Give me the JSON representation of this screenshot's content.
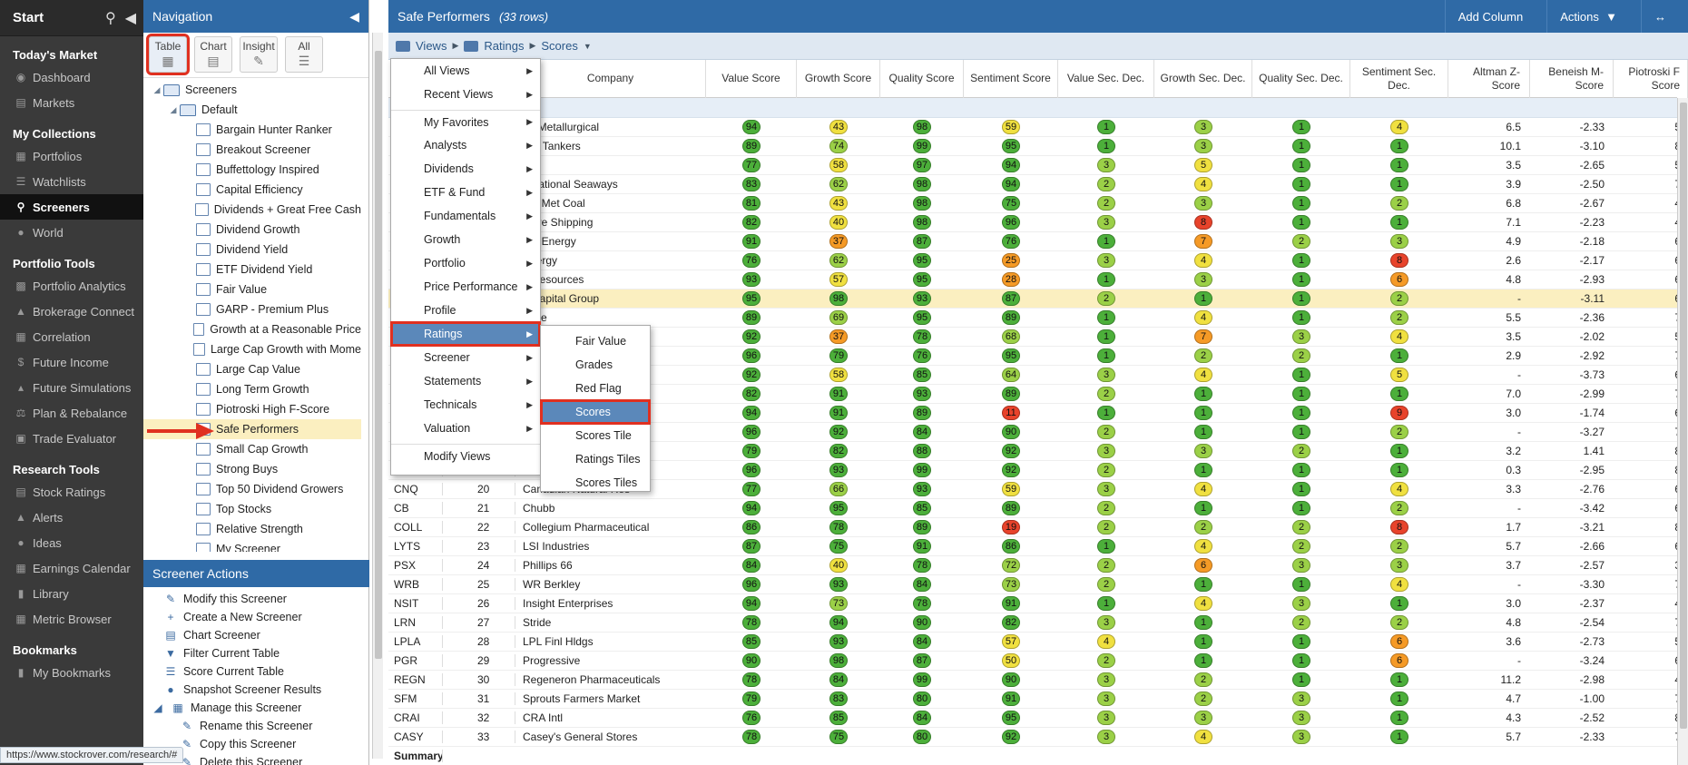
{
  "sidebar": {
    "start": "Start",
    "sections": [
      {
        "title": "Today's Market",
        "items": [
          {
            "label": "Dashboard",
            "icon": "gauge-icon"
          },
          {
            "label": "Markets",
            "icon": "chart-icon"
          }
        ]
      },
      {
        "title": "My Collections",
        "items": [
          {
            "label": "Portfolios",
            "icon": "building-icon"
          },
          {
            "label": "Watchlists",
            "icon": "list-icon"
          },
          {
            "label": "Screeners",
            "icon": "search-icon",
            "active": true
          },
          {
            "label": "World",
            "icon": "globe-icon"
          }
        ]
      },
      {
        "title": "Portfolio Tools",
        "items": [
          {
            "label": "Portfolio Analytics",
            "icon": "bars-icon"
          },
          {
            "label": "Brokerage Connect",
            "icon": "bank-icon"
          },
          {
            "label": "Correlation",
            "icon": "grid-icon"
          },
          {
            "label": "Future Income",
            "icon": "dollar-icon"
          },
          {
            "label": "Future Simulations",
            "icon": "flask-icon"
          },
          {
            "label": "Plan & Rebalance",
            "icon": "scale-icon"
          },
          {
            "label": "Trade Evaluator",
            "icon": "calculator-icon"
          }
        ]
      },
      {
        "title": "Research Tools",
        "items": [
          {
            "label": "Stock Ratings",
            "icon": "chart-icon"
          },
          {
            "label": "Alerts",
            "icon": "bell-icon"
          },
          {
            "label": "Ideas",
            "icon": "bulb-icon"
          },
          {
            "label": "Earnings Calendar",
            "icon": "calendar-icon"
          },
          {
            "label": "Library",
            "icon": "book-icon"
          },
          {
            "label": "Metric Browser",
            "icon": "table-icon"
          }
        ]
      },
      {
        "title": "Bookmarks",
        "items": [
          {
            "label": "My Bookmarks",
            "icon": "bookmark-icon"
          }
        ]
      }
    ]
  },
  "nav": {
    "title": "Navigation",
    "view_buttons": [
      {
        "label": "Table",
        "selected": true
      },
      {
        "label": "Chart"
      },
      {
        "label": "Insight"
      },
      {
        "label": "All"
      }
    ],
    "tree_root": "Screeners",
    "tree_folder": "Default",
    "screeners": [
      "Bargain Hunter Ranker",
      "Breakout Screener",
      "Buffettology Inspired",
      "Capital Efficiency",
      "Dividends + Great Free Cash",
      "Dividend Growth",
      "Dividend Yield",
      "ETF Dividend Yield",
      "Fair Value",
      "GARP - Premium Plus",
      "Growth at a Reasonable Price",
      "Large Cap Growth with Mome",
      "Large Cap Value",
      "Long Term Growth",
      "Piotroski High F-Score",
      "Safe Performers",
      "Small Cap Growth",
      "Strong Buys",
      "Top 50 Dividend Growers",
      "Top Stocks",
      "Relative Strength",
      "My Screener"
    ],
    "highlighted": "Safe Performers",
    "actions_title": "Screener Actions",
    "actions": [
      "Modify this Screener",
      "Create a New Screener",
      "Chart Screener",
      "Filter Current Table",
      "Score Current Table",
      "Snapshot Screener Results"
    ],
    "manage_group": "Manage this Screener",
    "manage_items": [
      "Rename this Screener",
      "Copy this Screener",
      "Delete this Screener"
    ],
    "status_url": "https://www.stockrover.com/research/#"
  },
  "main": {
    "title": "Safe Performers",
    "row_count": "(33 rows)",
    "add_column": "Add Column",
    "actions": "Actions",
    "crumbs": [
      "Views",
      "Ratings",
      "Scores"
    ]
  },
  "table": {
    "headers": [
      "Company",
      "Value Score",
      "Growth Score",
      "Quality Score",
      "Sentiment Score",
      "Value Sec. Dec.",
      "Growth Sec. Dec.",
      "Quality Sec. Dec.",
      "Sentiment Sec. Dec.",
      "Altman Z-Score",
      "Beneish M-Score",
      "Piotroski F Score"
    ],
    "colors": {
      "green": "#4caf3a",
      "lightgreen": "#9bd047",
      "yellow": "#f0e040",
      "orange": "#f59a26",
      "red": "#e8432b"
    },
    "rows": [
      {
        "ticker": "",
        "rank": "",
        "company": "na Metallurgical",
        "v": [
          94,
          43,
          98,
          59
        ],
        "d": [
          1,
          3,
          1,
          4
        ],
        "alt": "6.5",
        "ben": "-2.33",
        "pio": "5"
      },
      {
        "ticker": "",
        "rank": "",
        "company": "kay Tankers",
        "v": [
          89,
          74,
          99,
          95
        ],
        "d": [
          1,
          3,
          1,
          1
        ],
        "alt": "10.1",
        "ben": "-3.10",
        "pio": "8"
      },
      {
        "ticker": "",
        "rank": "",
        "company": "RM",
        "v": [
          77,
          58,
          97,
          94
        ],
        "d": [
          3,
          5,
          1,
          1
        ],
        "alt": "3.5",
        "ben": "-2.65",
        "pio": "5"
      },
      {
        "ticker": "",
        "rank": "",
        "company": "ernational Seaways",
        "v": [
          83,
          62,
          98,
          94
        ],
        "d": [
          2,
          4,
          1,
          1
        ],
        "alt": "3.9",
        "ben": "-2.50",
        "pio": "7"
      },
      {
        "ticker": "",
        "rank": "",
        "company": "rior Met Coal",
        "v": [
          81,
          43,
          98,
          75
        ],
        "d": [
          2,
          3,
          1,
          2
        ],
        "alt": "6.8",
        "ben": "-2.67",
        "pio": "4"
      },
      {
        "ticker": "",
        "rank": "",
        "company": "more Shipping",
        "v": [
          82,
          40,
          98,
          96
        ],
        "d": [
          3,
          8,
          1,
          1
        ],
        "alt": "7.1",
        "ben": "-2.23",
        "pio": "4"
      },
      {
        "ticker": "",
        "rank": "",
        "company": "ero Energy",
        "v": [
          91,
          37,
          87,
          76
        ],
        "d": [
          1,
          7,
          2,
          3
        ],
        "alt": "4.9",
        "ben": "-2.18",
        "pio": "6"
      },
      {
        "ticker": "",
        "rank": "",
        "company": "Energy",
        "v": [
          76,
          62,
          95,
          25
        ],
        "d": [
          3,
          4,
          1,
          8
        ],
        "alt": "2.6",
        "ben": "-2.17",
        "pio": "6"
      },
      {
        "ticker": "",
        "rank": "",
        "company": "n Resources",
        "v": [
          93,
          57,
          95,
          28
        ],
        "d": [
          1,
          3,
          1,
          6
        ],
        "alt": "4.8",
        "ben": "-2.93",
        "pio": "6"
      },
      {
        "ticker": "",
        "rank": "",
        "company": "n Capital Group",
        "v": [
          95,
          98,
          93,
          87
        ],
        "d": [
          2,
          1,
          1,
          2
        ],
        "alt": "-",
        "ben": "-3.11",
        "pio": "6",
        "hl": true
      },
      {
        "ticker": "",
        "rank": "",
        "company": "Fuse",
        "v": [
          89,
          69,
          95,
          89
        ],
        "d": [
          1,
          4,
          1,
          2
        ],
        "alt": "5.5",
        "ben": "-2.36",
        "pio": "7"
      },
      {
        "ticker": "",
        "rank": "",
        "company": "",
        "v": [
          92,
          37,
          78,
          68
        ],
        "d": [
          1,
          7,
          3,
          4
        ],
        "alt": "3.5",
        "ben": "-2.02",
        "pio": "5"
      },
      {
        "ticker": "",
        "rank": "",
        "company": "",
        "v": [
          96,
          79,
          76,
          95
        ],
        "d": [
          1,
          2,
          2,
          1
        ],
        "alt": "2.9",
        "ben": "-2.92",
        "pio": "7"
      },
      {
        "ticker": "",
        "rank": "",
        "company": "",
        "v": [
          92,
          58,
          85,
          64
        ],
        "d": [
          3,
          4,
          1,
          5
        ],
        "alt": "-",
        "ben": "-3.73",
        "pio": "6"
      },
      {
        "ticker": "",
        "rank": "",
        "company": "",
        "v": [
          82,
          91,
          93,
          89
        ],
        "d": [
          2,
          1,
          1,
          1
        ],
        "alt": "7.0",
        "ben": "-2.99",
        "pio": "7"
      },
      {
        "ticker": "",
        "rank": "",
        "company": "",
        "v": [
          94,
          91,
          89,
          11
        ],
        "d": [
          1,
          1,
          1,
          9
        ],
        "alt": "3.0",
        "ben": "-1.74",
        "pio": "6"
      },
      {
        "ticker": "",
        "rank": "",
        "company": "",
        "v": [
          96,
          92,
          84,
          90
        ],
        "d": [
          2,
          1,
          1,
          2
        ],
        "alt": "-",
        "ben": "-3.27",
        "pio": "7"
      },
      {
        "ticker": "",
        "rank": "",
        "company": "",
        "v": [
          79,
          82,
          88,
          92
        ],
        "d": [
          3,
          3,
          2,
          1
        ],
        "alt": "3.2",
        "ben": "1.41",
        "pio": "8"
      },
      {
        "ticker": "IBKR",
        "rank": "19",
        "company": "Inte",
        "v": [
          96,
          93,
          99,
          92
        ],
        "d": [
          2,
          1,
          1,
          1
        ],
        "alt": "0.3",
        "ben": "-2.95",
        "pio": "8"
      },
      {
        "ticker": "CNQ",
        "rank": "20",
        "company": "Canadian Natural Res",
        "v": [
          77,
          66,
          93,
          59
        ],
        "d": [
          3,
          4,
          1,
          4
        ],
        "alt": "3.3",
        "ben": "-2.76",
        "pio": "6"
      },
      {
        "ticker": "CB",
        "rank": "21",
        "company": "Chubb",
        "v": [
          94,
          95,
          85,
          89
        ],
        "d": [
          2,
          1,
          1,
          2
        ],
        "alt": "-",
        "ben": "-3.42",
        "pio": "6"
      },
      {
        "ticker": "COLL",
        "rank": "22",
        "company": "Collegium Pharmaceutical",
        "v": [
          86,
          78,
          89,
          19
        ],
        "d": [
          2,
          2,
          2,
          8
        ],
        "alt": "1.7",
        "ben": "-3.21",
        "pio": "8"
      },
      {
        "ticker": "LYTS",
        "rank": "23",
        "company": "LSI Industries",
        "v": [
          87,
          75,
          91,
          86
        ],
        "d": [
          1,
          4,
          2,
          2
        ],
        "alt": "5.7",
        "ben": "-2.66",
        "pio": "6"
      },
      {
        "ticker": "PSX",
        "rank": "24",
        "company": "Phillips 66",
        "v": [
          84,
          40,
          78,
          72
        ],
        "d": [
          2,
          6,
          3,
          3
        ],
        "alt": "3.7",
        "ben": "-2.57",
        "pio": "3"
      },
      {
        "ticker": "WRB",
        "rank": "25",
        "company": "WR Berkley",
        "v": [
          96,
          93,
          84,
          73
        ],
        "d": [
          2,
          1,
          1,
          4
        ],
        "alt": "-",
        "ben": "-3.30",
        "pio": "7"
      },
      {
        "ticker": "NSIT",
        "rank": "26",
        "company": "Insight Enterprises",
        "v": [
          94,
          73,
          78,
          91
        ],
        "d": [
          1,
          4,
          3,
          1
        ],
        "alt": "3.0",
        "ben": "-2.37",
        "pio": "4"
      },
      {
        "ticker": "LRN",
        "rank": "27",
        "company": "Stride",
        "v": [
          78,
          94,
          90,
          82
        ],
        "d": [
          3,
          1,
          2,
          2
        ],
        "alt": "4.8",
        "ben": "-2.54",
        "pio": "7"
      },
      {
        "ticker": "LPLA",
        "rank": "28",
        "company": "LPL Finl Hldgs",
        "v": [
          85,
          93,
          84,
          57
        ],
        "d": [
          4,
          1,
          1,
          6
        ],
        "alt": "3.6",
        "ben": "-2.73",
        "pio": "5"
      },
      {
        "ticker": "PGR",
        "rank": "29",
        "company": "Progressive",
        "v": [
          90,
          98,
          87,
          50
        ],
        "d": [
          2,
          1,
          1,
          6
        ],
        "alt": "-",
        "ben": "-3.24",
        "pio": "6"
      },
      {
        "ticker": "REGN",
        "rank": "30",
        "company": "Regeneron Pharmaceuticals",
        "v": [
          78,
          84,
          99,
          90
        ],
        "d": [
          3,
          2,
          1,
          1
        ],
        "alt": "11.2",
        "ben": "-2.98",
        "pio": "4"
      },
      {
        "ticker": "SFM",
        "rank": "31",
        "company": "Sprouts Farmers Market",
        "v": [
          79,
          83,
          80,
          91
        ],
        "d": [
          3,
          2,
          3,
          1
        ],
        "alt": "4.7",
        "ben": "-1.00",
        "pio": "7"
      },
      {
        "ticker": "CRAI",
        "rank": "32",
        "company": "CRA Intl",
        "v": [
          76,
          85,
          84,
          95
        ],
        "d": [
          3,
          3,
          3,
          1
        ],
        "alt": "4.3",
        "ben": "-2.52",
        "pio": "8"
      },
      {
        "ticker": "CASY",
        "rank": "33",
        "company": "Casey's General Stores",
        "v": [
          78,
          75,
          80,
          92
        ],
        "d": [
          3,
          4,
          3,
          1
        ],
        "alt": "5.7",
        "ben": "-2.33",
        "pio": "7"
      }
    ],
    "summary_label": "Summary"
  },
  "views_menu": {
    "items": [
      {
        "label": "All Views",
        "sub": true
      },
      {
        "label": "Recent Views",
        "sub": true
      },
      {
        "label": "My Favorites",
        "sub": true,
        "sep": true
      },
      {
        "label": "Analysts",
        "sub": true
      },
      {
        "label": "Dividends",
        "sub": true
      },
      {
        "label": "ETF & Fund",
        "sub": true
      },
      {
        "label": "Fundamentals",
        "sub": true
      },
      {
        "label": "Growth",
        "sub": true
      },
      {
        "label": "Portfolio",
        "sub": true
      },
      {
        "label": "Price Performance",
        "sub": true
      },
      {
        "label": "Profile",
        "sub": true
      },
      {
        "label": "Ratings",
        "sub": true,
        "selected": true
      },
      {
        "label": "Screener",
        "sub": true
      },
      {
        "label": "Statements",
        "sub": true
      },
      {
        "label": "Technicals",
        "sub": true
      },
      {
        "label": "Valuation",
        "sub": true
      },
      {
        "label": "Modify Views",
        "sub": false,
        "sep": true
      }
    ],
    "submenu": [
      "Fair Value",
      "Grades",
      "Red Flag",
      "Scores",
      "Scores Tile",
      "Ratings Tiles",
      "Scores Tiles"
    ],
    "submenu_selected": "Scores"
  }
}
